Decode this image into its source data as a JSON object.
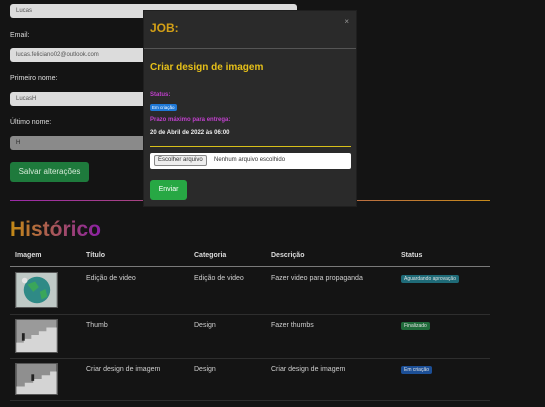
{
  "profile": {
    "username_value": "Lucas",
    "email_label": "Email:",
    "email_value": "lucas.feliciano02@outlook.com",
    "firstname_label": "Primeiro nome:",
    "firstname_value": "LucasH",
    "lastname_label": "Último nome:",
    "lastname_value": "H",
    "save_label": "Salvar alterações"
  },
  "history": {
    "title": "Histórico",
    "columns": [
      "Imagem",
      "Título",
      "Categoria",
      "Descrição",
      "Status"
    ],
    "rows": [
      {
        "title": "Edição de video",
        "category": "Edição de video",
        "description": "Fazer video para propaganda",
        "status": "Aguardando aprovação",
        "status_color": "#1f6b78"
      },
      {
        "title": "Thumb",
        "category": "Design",
        "description": "Fazer thumbs",
        "status": "Finalizado",
        "status_color": "#1f6b3a"
      },
      {
        "title": "Criar design de imagem",
        "category": "Design",
        "description": "Criar design de imagem",
        "status": "Em criação",
        "status_color": "#1c4f96"
      }
    ]
  },
  "modal": {
    "title": "JOB:",
    "close_icon": "×",
    "job_name": "Criar design de imagem",
    "status_label": "Status:",
    "status_value": "Em criação",
    "deadline_label": "Prazo máximo para entrega:",
    "deadline_value": "20 de Abril de 2022 às 06:00",
    "file_button": "Escolher arquivo",
    "file_text": "Nenhum arquivo escolhido",
    "send_label": "Enviar"
  }
}
